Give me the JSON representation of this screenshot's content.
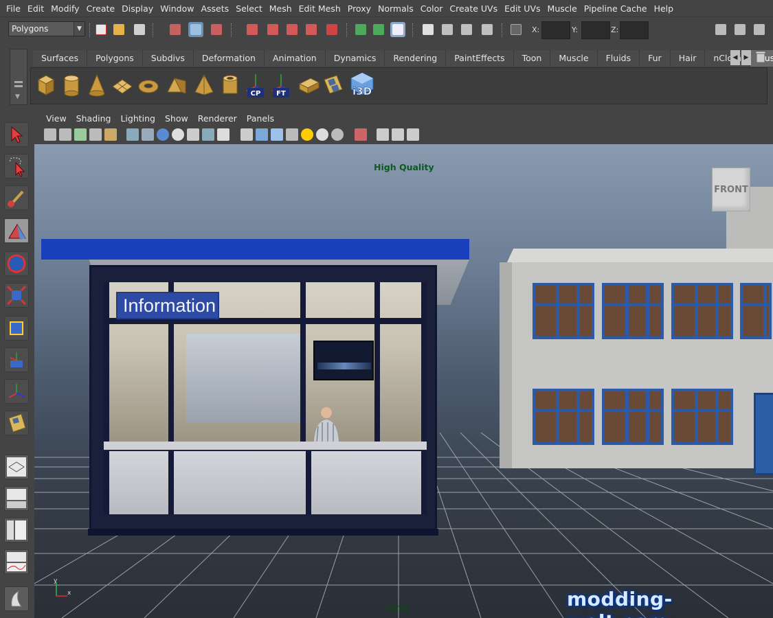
{
  "menubar": {
    "items": [
      "File",
      "Edit",
      "Modify",
      "Create",
      "Display",
      "Window",
      "Assets",
      "Select",
      "Mesh",
      "Edit Mesh",
      "Proxy",
      "Normals",
      "Color",
      "Create UVs",
      "Edit UVs",
      "Muscle",
      "Pipeline Cache",
      "Help"
    ]
  },
  "statusline": {
    "mode": "Polygons",
    "x_label": "X:",
    "y_label": "Y:",
    "z_label": "Z:"
  },
  "shelf": {
    "tabs": [
      "Surfaces",
      "Polygons",
      "Subdivs",
      "Deformation",
      "Animation",
      "Dynamics",
      "Rendering",
      "PaintEffects",
      "Toon",
      "Muscle",
      "Fluids",
      "Fur",
      "Hair",
      "nCloth",
      "Custom"
    ],
    "active_tab": "Custom",
    "buttons": [
      {
        "icon": "cube-icon"
      },
      {
        "icon": "cylinder-icon"
      },
      {
        "icon": "cone-icon"
      },
      {
        "icon": "plane-icon"
      },
      {
        "icon": "torus-icon"
      },
      {
        "icon": "prism-icon"
      },
      {
        "icon": "pyramid-icon"
      },
      {
        "icon": "pipe-icon"
      },
      {
        "icon": "center-pivot-icon",
        "label": "CP"
      },
      {
        "icon": "freeze-transform-icon",
        "label": "FT"
      },
      {
        "icon": "uv-editor-icon"
      },
      {
        "icon": "uv-layout-icon"
      },
      {
        "icon": "i3d-exporter-icon",
        "label": "i3D"
      }
    ]
  },
  "panel": {
    "menu": [
      "View",
      "Shading",
      "Lighting",
      "Show",
      "Renderer",
      "Panels"
    ]
  },
  "viewport": {
    "hud_quality": "High Quality",
    "camera_name": "persp",
    "viewcube_label": "FRONT",
    "watermark": "modding-welt.com",
    "sign_text": "Information"
  },
  "colors": {
    "ui_bg": "#444444",
    "roof_blue": "#1a3fbd",
    "window_blue": "#2a5aa8",
    "hud_green": "#0b5a1e"
  }
}
